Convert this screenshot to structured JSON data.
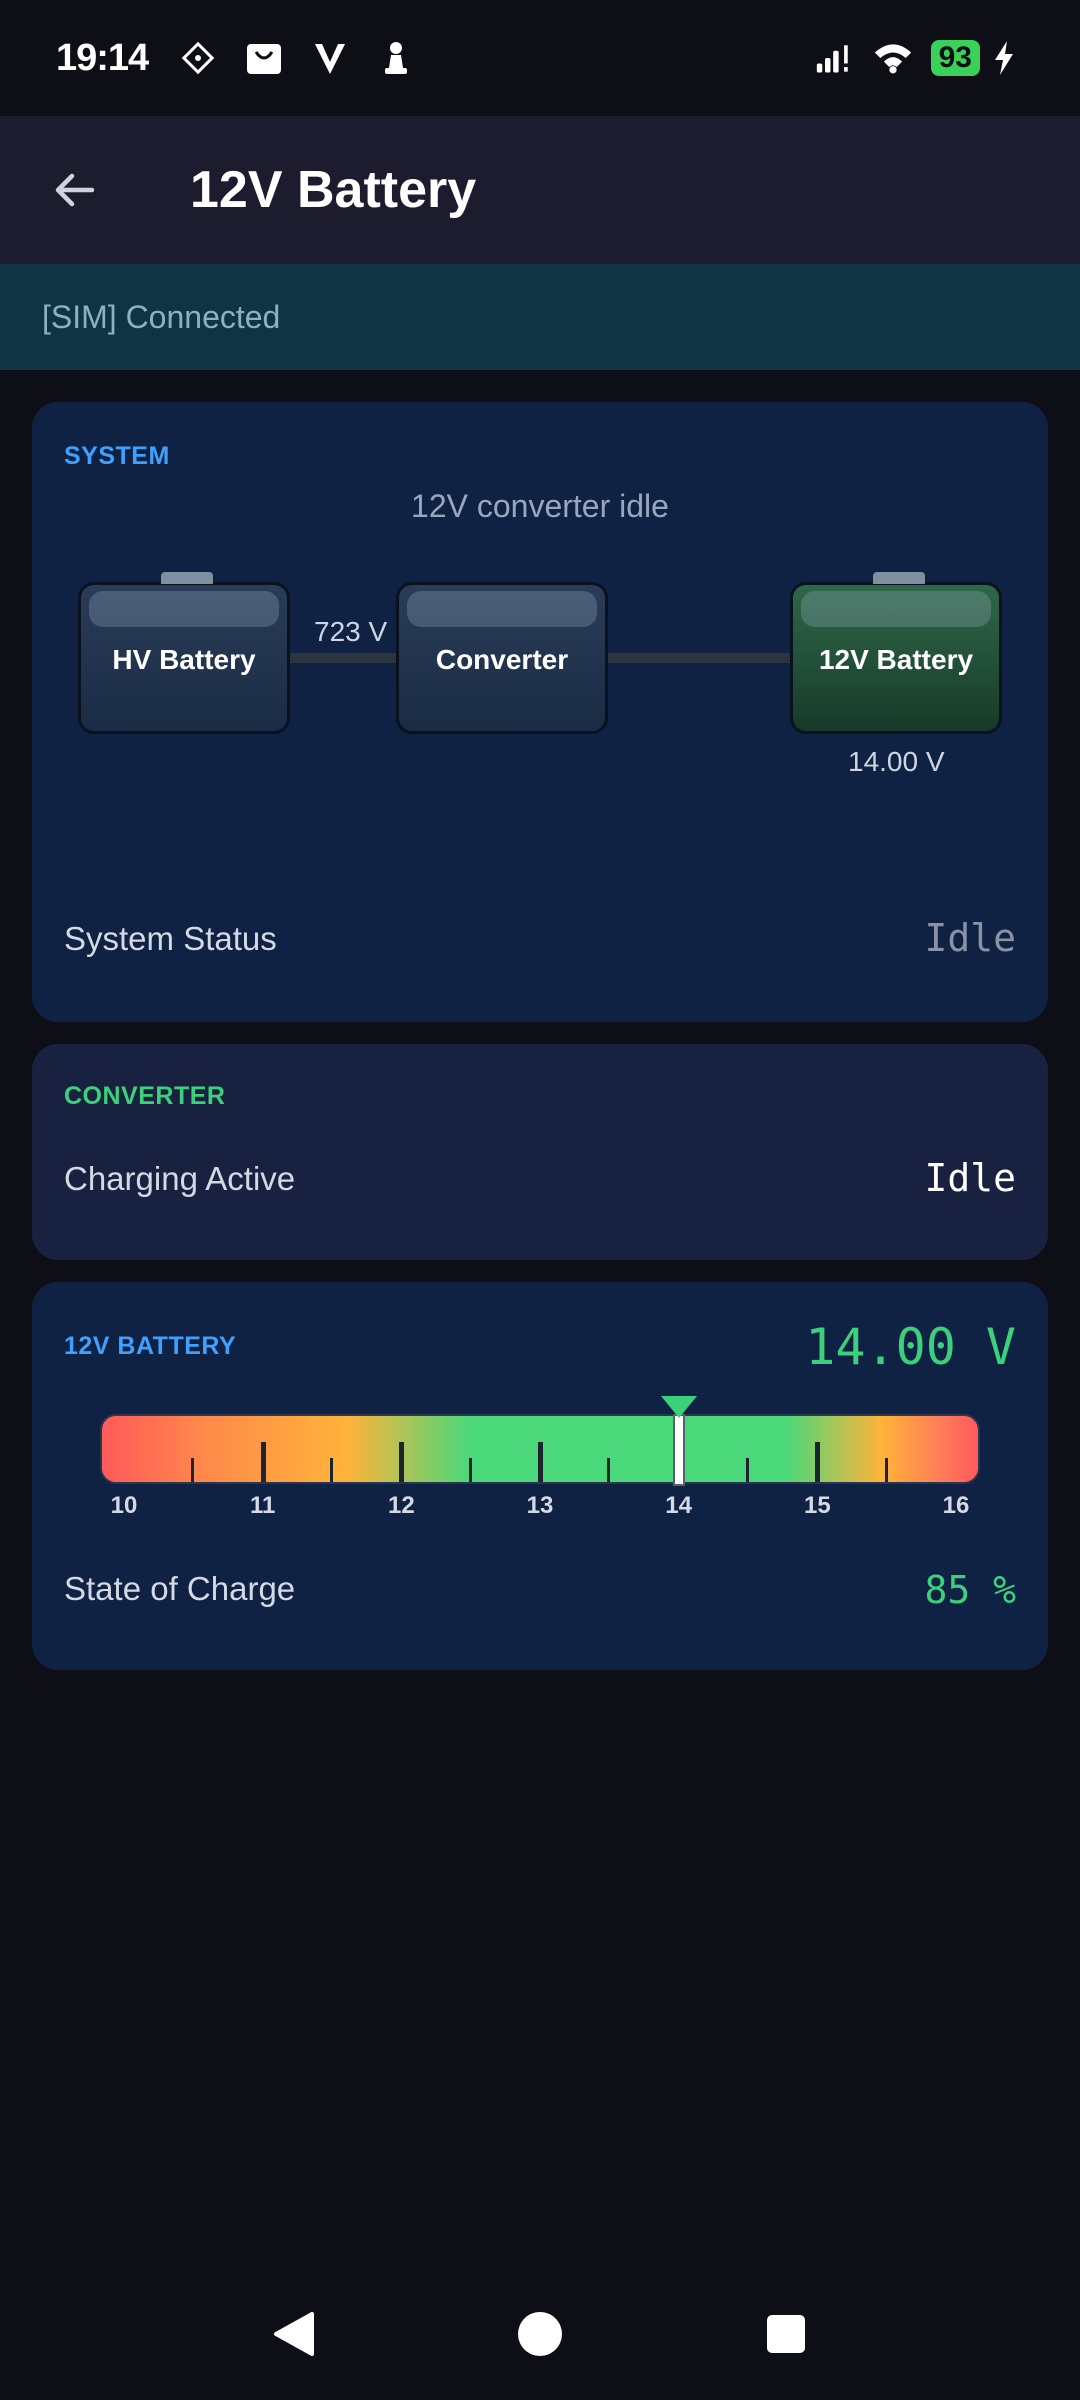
{
  "status_bar": {
    "time": "19:14",
    "left_icons": [
      "diamond-grid-icon",
      "shopping-bag-icon",
      "v-logo-icon",
      "chess-pawn-icon"
    ],
    "right_icons": [
      "signal-icon",
      "wifi-icon"
    ],
    "battery_level": "93",
    "charging": true
  },
  "app_bar": {
    "title": "12V Battery",
    "back_icon": "arrow-left-icon"
  },
  "connection": {
    "text": "[SIM] Connected"
  },
  "system_card": {
    "label": "SYSTEM",
    "caption": "12V converter idle",
    "nodes": {
      "hv": "HV Battery",
      "converter": "Converter",
      "lv": "12V Battery"
    },
    "hv_voltage": "723 V",
    "lv_voltage": "14.00 V",
    "status_label": "System Status",
    "status_value": "Idle"
  },
  "converter_card": {
    "label": "CONVERTER",
    "row_label": "Charging Active",
    "row_value": "Idle"
  },
  "battery_card": {
    "label": "12V BATTERY",
    "voltage": "14.00 V",
    "gauge": {
      "min": 10,
      "max": 16,
      "value": 14.0,
      "tick_labels": [
        "10",
        "11",
        "12",
        "13",
        "14",
        "15",
        "16"
      ]
    },
    "soc_label": "State of Charge",
    "soc_value": "85 %"
  },
  "colors": {
    "accent_blue": "#3fa0ff",
    "accent_green": "#3dd07a",
    "card_bg": "#0f2244"
  },
  "nav_bar": {
    "icons": [
      "back-triangle-icon",
      "home-circle-icon",
      "recents-square-icon"
    ]
  }
}
